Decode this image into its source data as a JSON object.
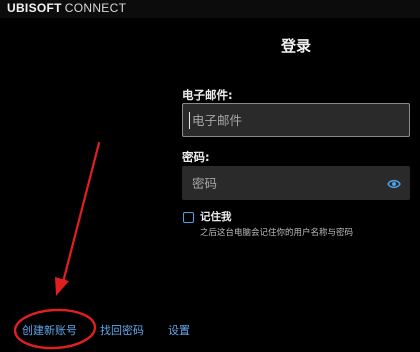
{
  "titlebar": {
    "brand_bold": "UBISOFT",
    "brand_thin": "CONNECT"
  },
  "login": {
    "title": "登录",
    "email_label": "电子邮件:",
    "email_placeholder": "电子邮件",
    "password_label": "密码:",
    "password_placeholder": "密码",
    "remember_label": "记住我",
    "remember_hint": "之后这台电脑会记住你的用户名称与密码"
  },
  "footer": {
    "create_account": "创建新账号",
    "forgot_password": "找回密码",
    "settings": "设置"
  },
  "colors": {
    "background": "#000000",
    "input_background": "#2a2a2a",
    "link": "#63a7ec",
    "checkbox": "#4aa3e6",
    "annotation": "#e02020"
  },
  "icons": {
    "password_visibility": "eye-icon"
  }
}
